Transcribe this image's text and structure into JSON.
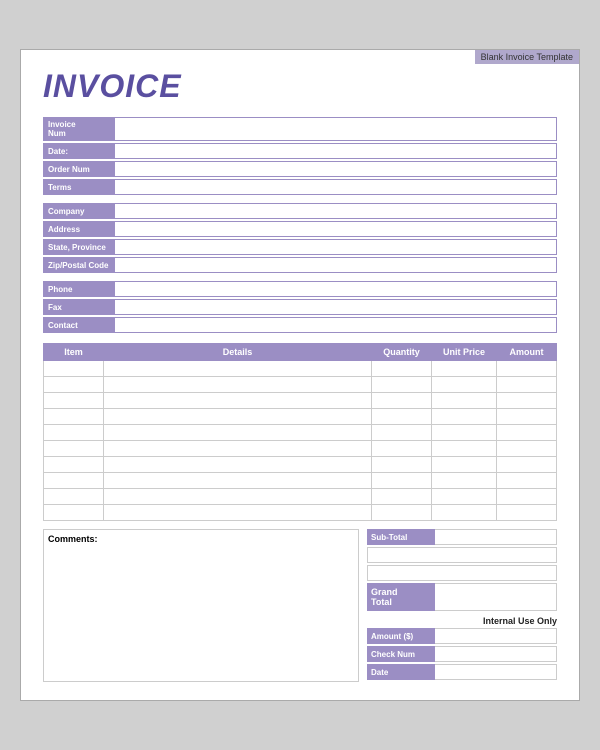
{
  "template": {
    "label": "Blank Invoice Template"
  },
  "invoice": {
    "title": "INVOICE"
  },
  "fields": {
    "invoice_num_label": "Invoice\nNum",
    "date_label": "Date:",
    "order_num_label": "Order Num",
    "terms_label": "Terms",
    "company_label": "Company",
    "address_label": "Address",
    "state_province_label": "State, Province",
    "zip_postal_label": "Zip/Postal Code",
    "phone_label": "Phone",
    "fax_label": "Fax",
    "contact_label": "Contact"
  },
  "table": {
    "headers": {
      "item": "Item",
      "details": "Details",
      "quantity": "Quantity",
      "unit_price": "Unit Price",
      "amount": "Amount"
    },
    "rows": 10
  },
  "totals": {
    "sub_total_label": "Sub-Total",
    "grand_total_label": "Grand\nTotal",
    "internal_use_label": "Internal Use Only",
    "amount_label": "Amount ($)",
    "check_num_label": "Check Num",
    "date_label": "Date"
  },
  "comments": {
    "label": "Comments:"
  }
}
